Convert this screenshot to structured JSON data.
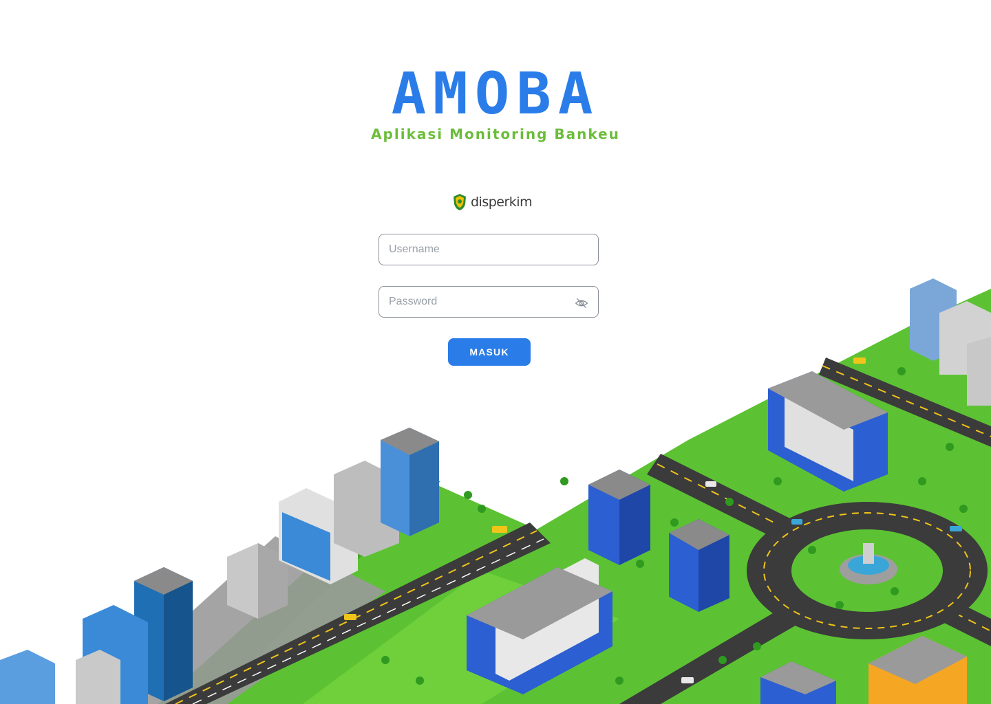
{
  "app": {
    "title": "AMOBA",
    "subtitle": "Aplikasi Monitoring Bankeu"
  },
  "brand": {
    "name": "disperkim",
    "icon": "province-emblem-icon"
  },
  "login": {
    "username_placeholder": "Username",
    "password_placeholder": "Password",
    "password_toggle_icon": "eye-off-icon",
    "submit_label": "MASUK"
  },
  "colors": {
    "primary": "#2a7de8",
    "accent_green": "#6bbd3a",
    "field_border": "#8a8f99"
  },
  "illustration": "isometric-city-illustration"
}
